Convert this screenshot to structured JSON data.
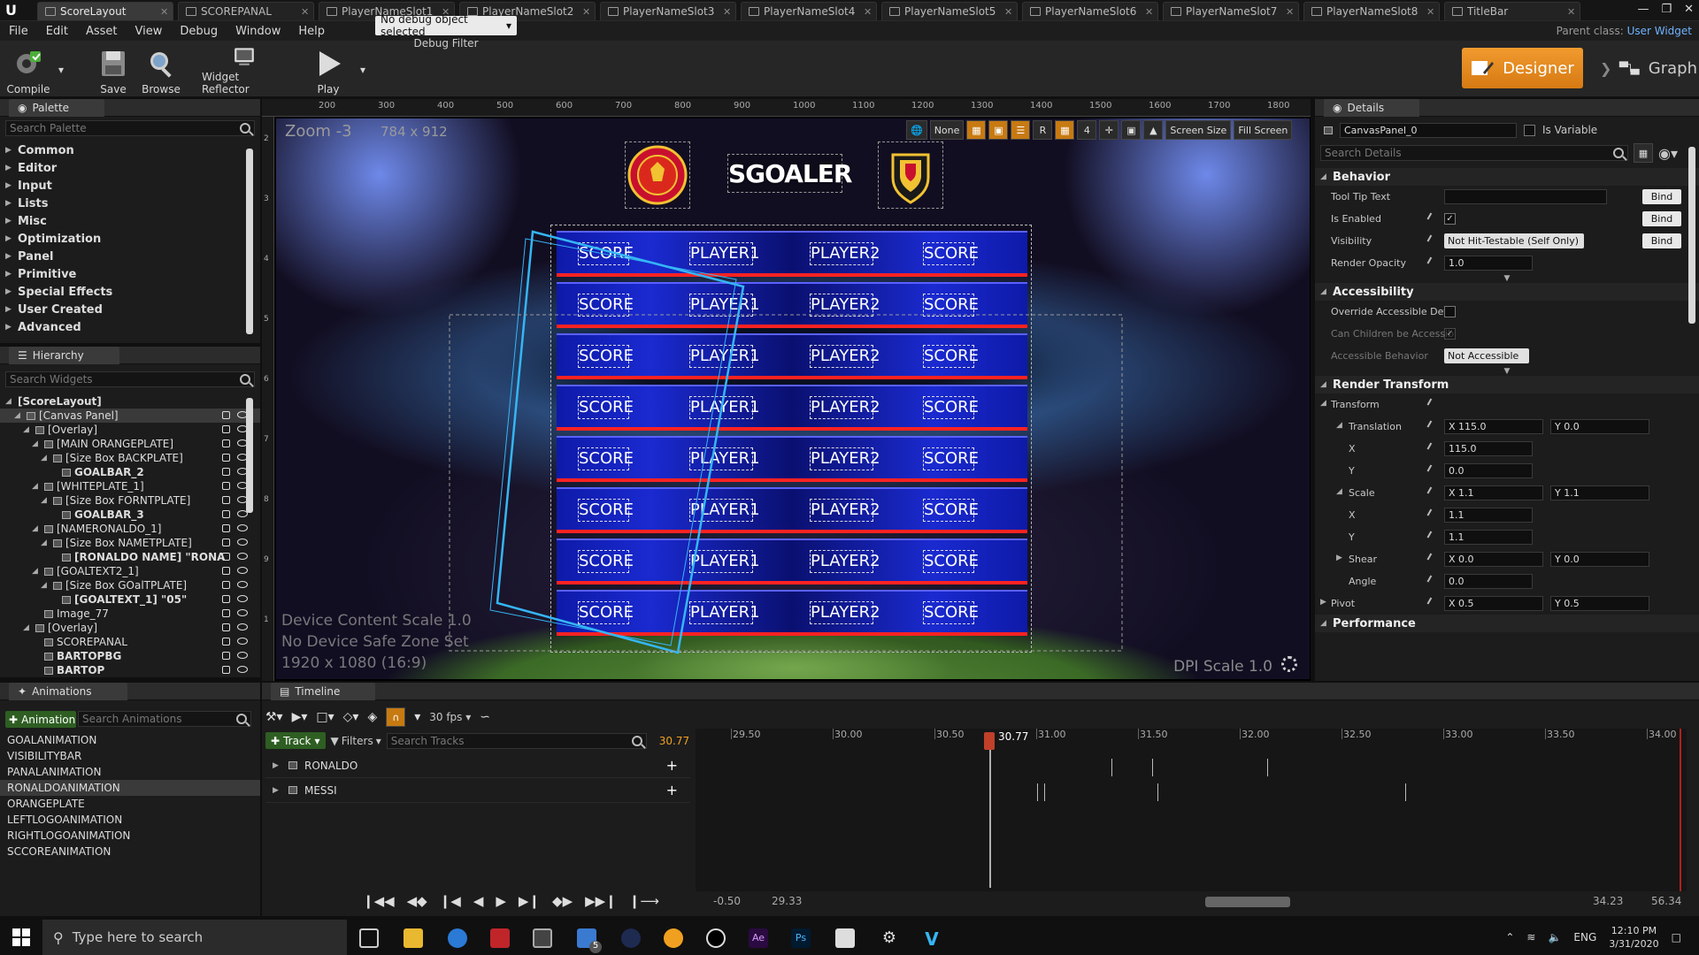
{
  "tabs": [
    {
      "label": "ScoreLayout",
      "active": true
    },
    {
      "label": "SCOREPANAL"
    },
    {
      "label": "PlayerNameSlot1"
    },
    {
      "label": "PlayerNameSlot2"
    },
    {
      "label": "PlayerNameSlot3"
    },
    {
      "label": "PlayerNameSlot4"
    },
    {
      "label": "PlayerNameSlot5"
    },
    {
      "label": "PlayerNameSlot6"
    },
    {
      "label": "PlayerNameSlot7"
    },
    {
      "label": "PlayerNameSlot8"
    },
    {
      "label": "TitleBar"
    }
  ],
  "menu": [
    "File",
    "Edit",
    "Asset",
    "View",
    "Debug",
    "Window",
    "Help"
  ],
  "parent_class": {
    "label": "Parent class:",
    "value": "User Widget"
  },
  "toolbar": {
    "compile": "Compile",
    "save": "Save",
    "browse": "Browse",
    "reflector": "Widget Reflector",
    "play": "Play",
    "debug_selected": "No debug object selected",
    "debug_filter": "Debug Filter",
    "designer": "Designer",
    "graph": "Graph"
  },
  "palette": {
    "title": "Palette",
    "search_placeholder": "Search Palette",
    "categories": [
      "Common",
      "Editor",
      "Input",
      "Lists",
      "Misc",
      "Optimization",
      "Panel",
      "Primitive",
      "Special Effects",
      "User Created",
      "Advanced"
    ]
  },
  "hierarchy": {
    "title": "Hierarchy",
    "search_placeholder": "Search Widgets",
    "rows": [
      {
        "label": "[ScoreLayout]",
        "bold": true
      },
      {
        "label": "[Canvas Panel]",
        "selected": true
      },
      {
        "label": "[Overlay]"
      },
      {
        "label": "[MAIN ORANGEPLATE]"
      },
      {
        "label": "[Size Box BACKPLATE]"
      },
      {
        "label": "GOALBAR_2",
        "bold": true
      },
      {
        "label": "[WHITEPLATE_1]"
      },
      {
        "label": "[Size Box FORNTPLATE]"
      },
      {
        "label": "GOALBAR_3",
        "bold": true
      },
      {
        "label": "[NAMERONALDO_1]"
      },
      {
        "label": "[Size Box NAMETPLATE]"
      },
      {
        "label": "[RONALDO NAME] \"RONA",
        "bold": true
      },
      {
        "label": "[GOALTEXT2_1]"
      },
      {
        "label": "[Size Box GOalTPLATE]"
      },
      {
        "label": "[GOALTEXT_1] \"05\"",
        "bold": true
      },
      {
        "label": "Image_77"
      },
      {
        "label": "[Overlay]"
      },
      {
        "label": "SCOREPANAL"
      },
      {
        "label": "BARTOPBG",
        "bold": true
      },
      {
        "label": "BARTOP",
        "bold": true
      }
    ]
  },
  "viewport": {
    "zoom": "Zoom -3",
    "dims": "784 x 912",
    "safe_zone": [
      "Device Content Scale 1.0",
      "No Device Safe Zone Set",
      "1920 x 1080 (16:9)"
    ],
    "dpi": "DPI Scale 1.0",
    "tools": [
      "None",
      "R",
      "4",
      "Screen Size",
      "Fill Screen"
    ],
    "ruler_top": [
      "200",
      "300",
      "400",
      "500",
      "600",
      "700",
      "800",
      "900",
      "1000",
      "1100",
      "1200",
      "1300",
      "1400",
      "1500",
      "1600",
      "1700",
      "1800"
    ],
    "ruler_left": [
      "2",
      "3",
      "4",
      "5",
      "6",
      "7",
      "8",
      "9",
      "1"
    ],
    "title_text": "SGOALER",
    "row_cells": [
      "SCORE",
      "PLAYER1",
      "PLAYER2",
      "SCORE"
    ],
    "row_count": 8,
    "colors": {
      "row_blue": "#1a2ad0",
      "row_red": "#ff2222"
    }
  },
  "details": {
    "title": "Details",
    "object": "CanvasPanel_0",
    "is_variable": "Is Variable",
    "search_placeholder": "Search Details",
    "behavior": {
      "title": "Behavior",
      "tooltip": "Tool Tip Text",
      "enabled": "Is Enabled",
      "visibility": "Visibility",
      "visibility_value": "Not Hit-Testable (Self Only)",
      "opacity": "Render Opacity",
      "opacity_value": "1.0",
      "bind": "Bind"
    },
    "accessibility": {
      "title": "Accessibility",
      "override": "Override Accessible Defa",
      "children": "Can Children be Accessib",
      "behavior": "Accessible Behavior",
      "behavior_value": "Not Accessible"
    },
    "render": {
      "title": "Render Transform",
      "transform": "Transform",
      "translation": "Translation",
      "tx": "X  115.0",
      "ty": "Y  0.0",
      "x": "X",
      "xv": "115.0",
      "y": "Y",
      "yv": "0.0",
      "scale": "Scale",
      "sx": "X  1.1",
      "sy": "Y  1.1",
      "scx": "1.1",
      "scy": "1.1",
      "shear": "Shear",
      "shx": "X  0.0",
      "shy": "Y  0.0",
      "angle": "Angle",
      "anglev": "0.0",
      "pivot": "Pivot",
      "px": "X  0.5",
      "py": "Y  0.5"
    },
    "performance": "Performance"
  },
  "animations": {
    "title": "Animations",
    "add": "Animation",
    "search_placeholder": "Search Animations",
    "items": [
      {
        "label": "GOALANIMATION"
      },
      {
        "label": "VISIBILITYBAR"
      },
      {
        "label": "PANALANIMATION"
      },
      {
        "label": "RONALDOANIMATION",
        "selected": true
      },
      {
        "label": "ORANGEPLATE"
      },
      {
        "label": "LEFTLOGOANIMATION"
      },
      {
        "label": "RIGHTLOGOANIMATION"
      },
      {
        "label": "SCCOREANIMATION"
      }
    ]
  },
  "timeline": {
    "title": "Timeline",
    "fps": "30 fps",
    "track": "Track",
    "filters": "Filters",
    "search_placeholder": "Search Tracks",
    "current": "30.77",
    "tracks": [
      "RONALDO",
      "MESSI"
    ],
    "ticks": [
      "29.50",
      "30.00",
      "30.50",
      "31.00",
      "31.50",
      "32.00",
      "32.50",
      "33.00",
      "33.50",
      "34.00"
    ],
    "range_start": "-0.50",
    "view_start": "29.33",
    "view_end": "34.23",
    "range_end": "56.34"
  },
  "taskbar": {
    "search_placeholder": "Type here to search",
    "lang": "ENG",
    "time": "12:10 PM",
    "date": "3/31/2020",
    "badge": "5"
  }
}
